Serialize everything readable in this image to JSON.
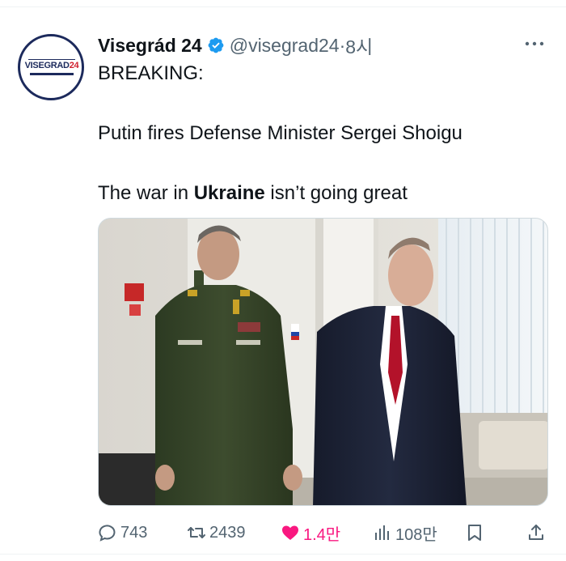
{
  "tweet": {
    "author": {
      "display_name": "Visegrád 24",
      "handle": "@visegrad24",
      "time_separator": " · ",
      "time": "8시",
      "verified": true,
      "avatar_logo_text": "VISEGRAD",
      "avatar_logo_number": "24",
      "avatar_colors": {
        "navy": "#1c2a5c",
        "red": "#d0202e"
      }
    },
    "text": {
      "line1": "BREAKING:",
      "line2": "Putin fires Defense Minister Sergei Shoigu",
      "line3_pre": "The war in ",
      "line3_bold": "Ukraine",
      "line3_post": " isn’t going great"
    },
    "media": {
      "type": "photo"
    },
    "actions": {
      "replies": "743",
      "retweets": "2439",
      "likes": "1.4만",
      "views": "108만"
    }
  },
  "colors": {
    "text_primary": "#0f1419",
    "text_secondary": "#536471",
    "verified_blue": "#1d9bf0",
    "like_pink": "#f91880",
    "divider": "#eff3f4"
  },
  "icons": {
    "verified": "verified-badge-icon",
    "more": "more-dots-icon",
    "reply": "reply-bubble-icon",
    "retweet": "retweet-icon",
    "like": "heart-filled-icon",
    "views": "views-bars-icon",
    "bookmark": "bookmark-icon",
    "share": "share-upload-icon"
  }
}
